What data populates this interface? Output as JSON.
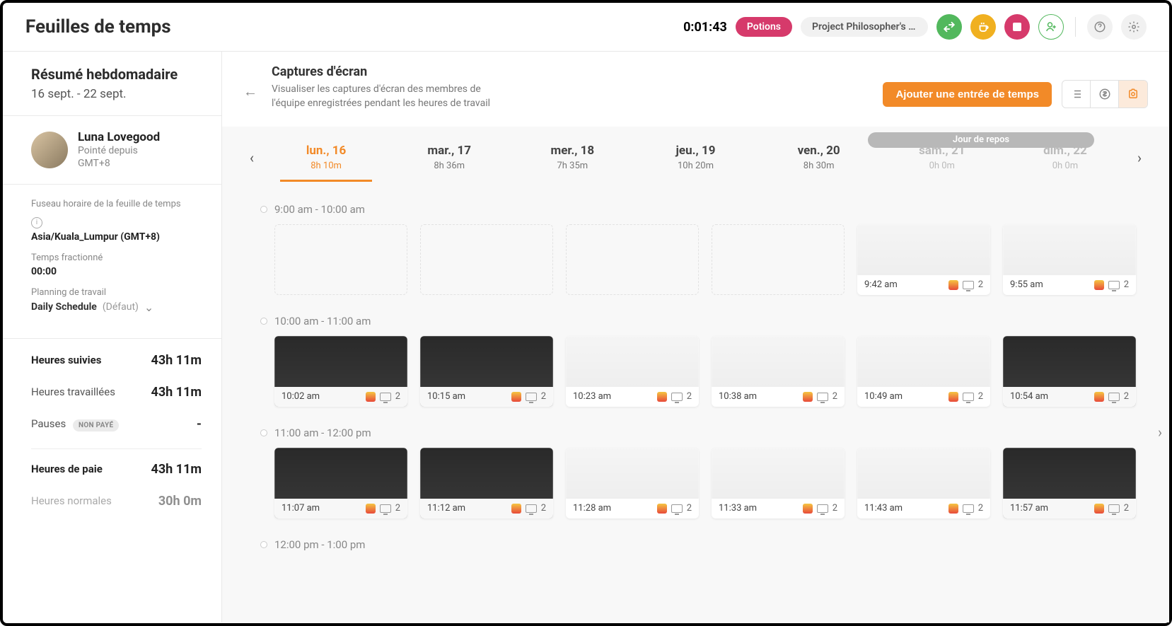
{
  "header": {
    "title": "Feuilles de temps",
    "timer": "0:01:43",
    "tag": "Potions",
    "project": "Project Philosopher's S…"
  },
  "sidebar": {
    "summary_title": "Résumé hebdomadaire",
    "summary_range": "16 sept. - 22 sept.",
    "user": {
      "name": "Luna Lovegood",
      "status": "Pointé depuis",
      "tz_short": "GMT+8"
    },
    "tz_label": "Fuseau horaire de la feuille de temps",
    "tz_value": "Asia/Kuala_Lumpur (GMT+8)",
    "split_label": "Temps fractionné",
    "split_value": "00:00",
    "schedule_label": "Planning de travail",
    "schedule_value": "Daily Schedule",
    "schedule_default": "(Défaut)",
    "stats": {
      "tracked_label": "Heures suivies",
      "tracked_val": "43h 11m",
      "worked_label": "Heures travaillées",
      "worked_val": "43h 11m",
      "breaks_label": "Pauses",
      "breaks_badge": "NON PAYÉ",
      "breaks_val": "-",
      "pay_label": "Heures de paie",
      "pay_val": "43h 11m",
      "normal_label": "Heures normales",
      "normal_val": "30h 0m"
    }
  },
  "main": {
    "back_icon": "←",
    "title": "Captures d'écran",
    "desc": "Visualiser les captures d'écran des membres de l'équipe enregistrées pendant les heures de travail",
    "add_btn": "Ajouter une entrée de temps",
    "rest_label": "Jour de repos"
  },
  "days": [
    {
      "label": "lun., 16",
      "dur": "8h 10m",
      "active": true
    },
    {
      "label": "mar., 17",
      "dur": "8h 36m"
    },
    {
      "label": "mer., 18",
      "dur": "7h 35m"
    },
    {
      "label": "jeu., 19",
      "dur": "10h 20m"
    },
    {
      "label": "ven., 20",
      "dur": "8h 30m"
    },
    {
      "label": "sam., 21",
      "dur": "0h 0m",
      "rest": true
    },
    {
      "label": "dim., 22",
      "dur": "0h 0m",
      "rest": true
    }
  ],
  "timeblocks": [
    {
      "range": "9:00 am - 10:00 am",
      "shots": [
        {
          "empty": true
        },
        {
          "empty": true
        },
        {
          "empty": true
        },
        {
          "empty": true
        },
        {
          "time": "9:42 am",
          "count": "2",
          "style": "light"
        },
        {
          "time": "9:55 am",
          "count": "2",
          "style": "light"
        }
      ]
    },
    {
      "range": "10:00 am - 11:00 am",
      "shots": [
        {
          "time": "10:02 am",
          "count": "2",
          "style": "dark"
        },
        {
          "time": "10:15 am",
          "count": "2",
          "style": "dark"
        },
        {
          "time": "10:23 am",
          "count": "2",
          "style": "light"
        },
        {
          "time": "10:38 am",
          "count": "2",
          "style": "light"
        },
        {
          "time": "10:49 am",
          "count": "2",
          "style": "light"
        },
        {
          "time": "10:54 am",
          "count": "2",
          "style": "dark"
        }
      ]
    },
    {
      "range": "11:00 am - 12:00 pm",
      "shots": [
        {
          "time": "11:07 am",
          "count": "2",
          "style": "dark"
        },
        {
          "time": "11:12 am",
          "count": "2",
          "style": "dark"
        },
        {
          "time": "11:28 am",
          "count": "2",
          "style": "light"
        },
        {
          "time": "11:33 am",
          "count": "2",
          "style": "light"
        },
        {
          "time": "11:43 am",
          "count": "2",
          "style": "light"
        },
        {
          "time": "11:57 am",
          "count": "2",
          "style": "dark"
        }
      ]
    },
    {
      "range": "12:00 pm - 1:00 pm",
      "shots": []
    }
  ]
}
